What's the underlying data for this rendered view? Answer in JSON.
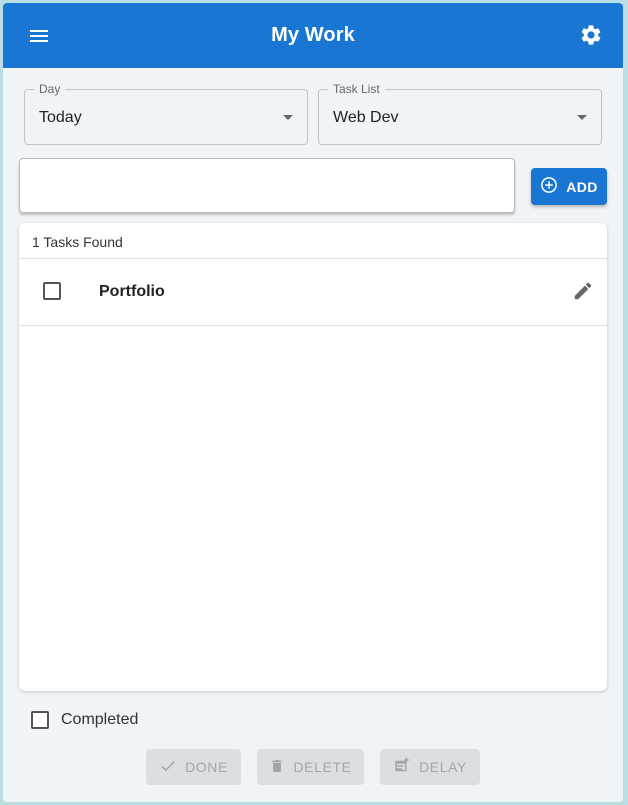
{
  "header": {
    "title": "My Work",
    "menu_icon": "menu-icon",
    "settings_icon": "gear-icon",
    "color": "#1976d2"
  },
  "filters": {
    "day": {
      "label": "Day",
      "value": "Today"
    },
    "task_list": {
      "label": "Task List",
      "value": "Web Dev"
    }
  },
  "task_input": {
    "value": "",
    "placeholder": ""
  },
  "add_button": {
    "label": "ADD",
    "icon": "plus-circle-icon"
  },
  "tasks_panel": {
    "count_text": "1 Tasks Found",
    "tasks": [
      {
        "name": "Portfolio",
        "checked": false,
        "edit_icon": "pencil-icon"
      }
    ]
  },
  "completed_toggle": {
    "label": "Completed",
    "checked": false
  },
  "actions": [
    {
      "label": "DONE",
      "icon": "check-icon",
      "disabled": true
    },
    {
      "label": "DELETE",
      "icon": "trash-icon",
      "disabled": true
    },
    {
      "label": "DELAY",
      "icon": "calendar-plus-icon",
      "disabled": true
    }
  ]
}
